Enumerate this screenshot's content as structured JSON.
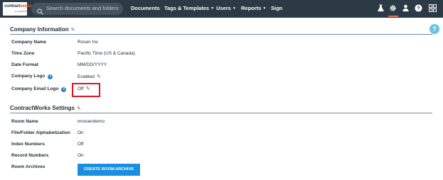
{
  "header": {
    "logo_text_main": "contract",
    "logo_text_accent": "works",
    "logo_sub": "by SharePoint",
    "search_placeholder": "Search documents and folders",
    "nav": [
      {
        "label": "Documents",
        "has_menu": false
      },
      {
        "label": "Tags & Templates",
        "has_menu": true
      },
      {
        "label": "Users",
        "has_menu": true
      },
      {
        "label": "Reports",
        "has_menu": true
      },
      {
        "label": "Sign",
        "has_menu": false
      }
    ],
    "icons": [
      "flask-icon",
      "gear-icon",
      "user-icon",
      "help-circle-icon",
      "apps-grid-icon"
    ],
    "active_icon": "gear-icon"
  },
  "help_button": "?",
  "company_information": {
    "title": "Company Information",
    "rows": [
      {
        "label": "Company Name",
        "value": "Rosen Inc"
      },
      {
        "label": "Time Zone",
        "value": "Pacific Time (US & Canada)"
      },
      {
        "label": "Date Format",
        "value": "MM/DD/YYYY"
      },
      {
        "label": "Company Logo",
        "value": "Enabled"
      },
      {
        "label": "Company Email Logo",
        "value": "Off"
      }
    ]
  },
  "contractworks_settings": {
    "title": "ContractWorks Settings",
    "rows": [
      {
        "label": "Room Name",
        "value": "mrosendemo"
      },
      {
        "label": "File/Folder Alphabetization",
        "value": "On"
      },
      {
        "label": "Index Numbers",
        "value": "Off"
      },
      {
        "label": "Record Numbers",
        "value": "On"
      },
      {
        "label": "Room Archives",
        "value": ""
      }
    ],
    "create_archive_label": "CREATE ROOM ARCHIVE"
  },
  "colors": {
    "topbar": "#2b3a44",
    "accent_orange": "#e8734f",
    "primary_blue": "#1a8fe0",
    "highlight_red": "#e0131c"
  }
}
